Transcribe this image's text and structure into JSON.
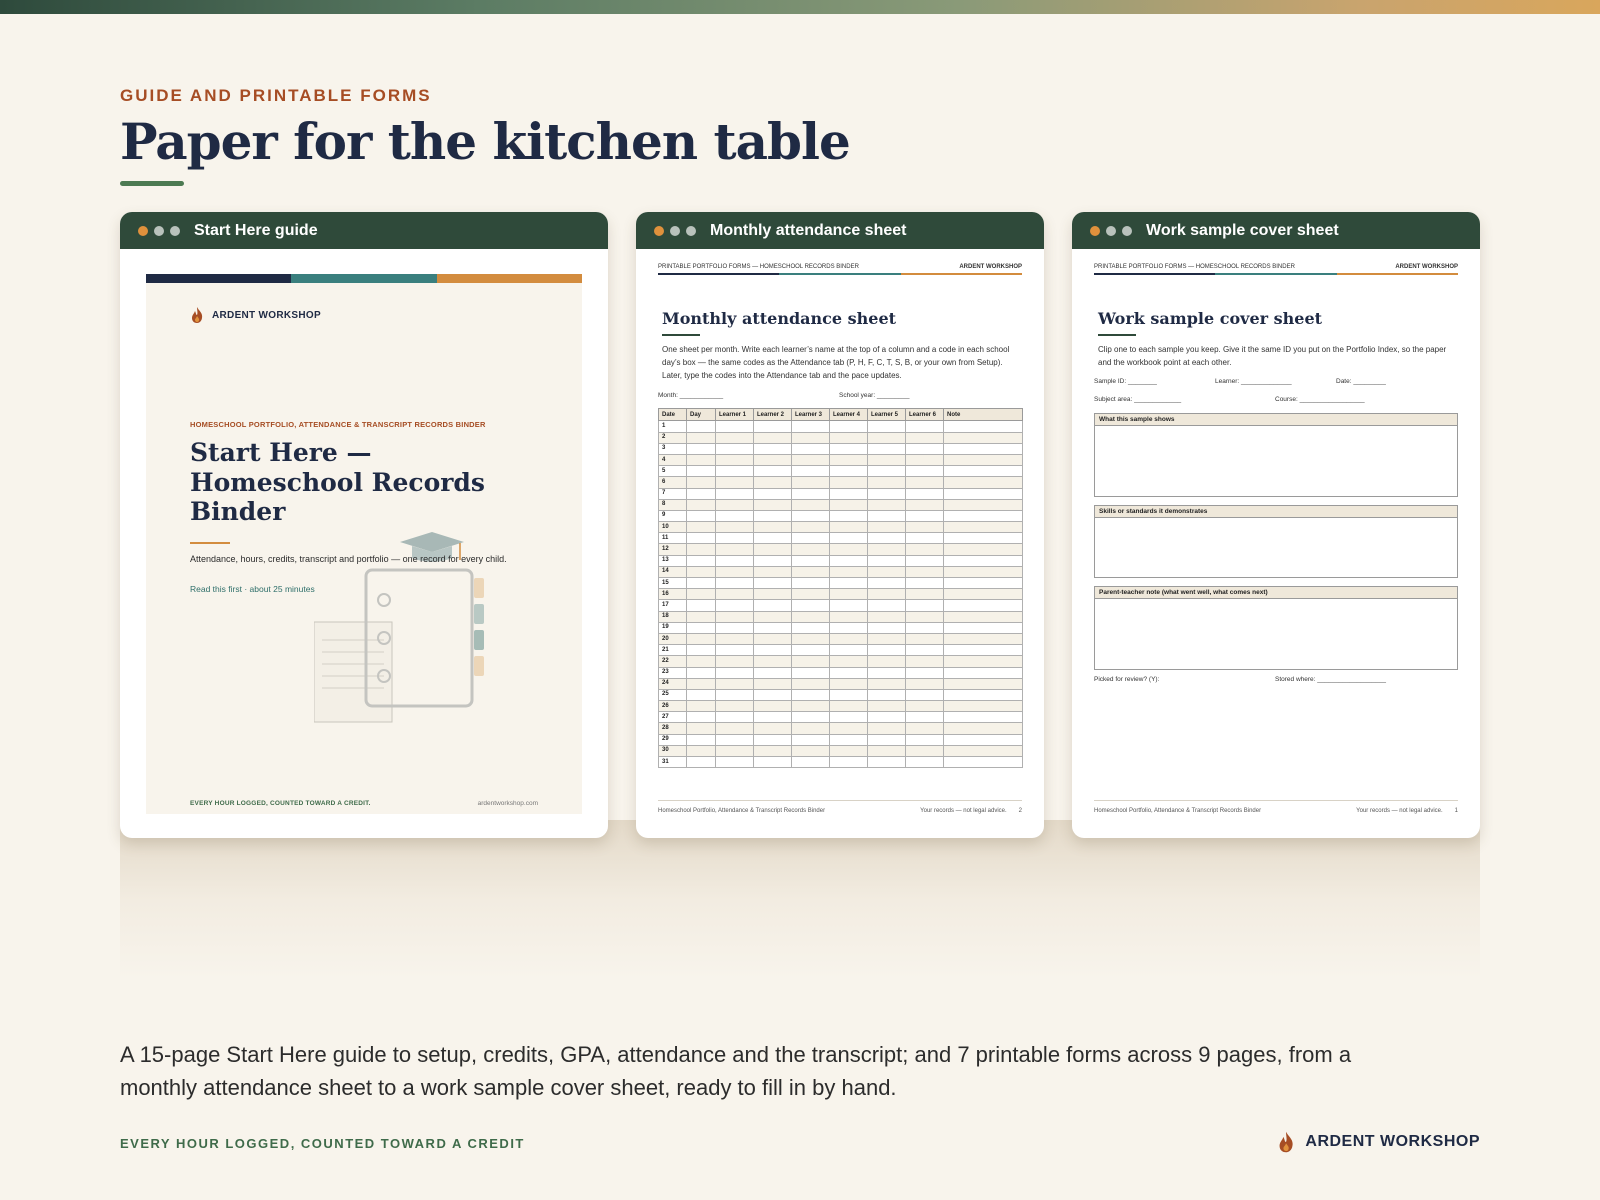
{
  "header": {
    "eyebrow": "GUIDE AND PRINTABLE FORMS",
    "title": "Paper for the kitchen table"
  },
  "colors": {
    "navy": "#1f2a44",
    "teal": "#3a7f7e",
    "amber": "#d38c3e",
    "forest": "#2f4a3a",
    "rust": "#a64d24",
    "background": "#f8f4ec"
  },
  "windows": {
    "guide": {
      "title": "Start Here guide",
      "brand": "ARDENT WORKSHOP",
      "brand_icon": "flame-logo-icon",
      "eyebrow": "HOMESCHOOL PORTFOLIO, ATTENDANCE & TRANSCRIPT RECORDS BINDER",
      "title_lines": [
        "Start Here —",
        "Homeschool Records",
        "Binder"
      ],
      "description": "Attendance, hours, credits, transcript and portfolio — one record for every child.",
      "read_note": "Read this first · about 25 minutes",
      "illustration": "binder-and-graduation-cap-icon",
      "footer_left": "EVERY HOUR LOGGED, COUNTED TOWARD A CREDIT.",
      "footer_right": "ardentworkshop.com"
    },
    "attendance": {
      "title": "Monthly attendance sheet",
      "header_left": "PRINTABLE PORTFOLIO FORMS — HOMESCHOOL RECORDS BINDER",
      "header_right": "ARDENT WORKSHOP",
      "form_title": "Monthly attendance sheet",
      "description": "One sheet per month. Write each learner’s name at the top of a column and a code in each school day’s box — the same codes as the Attendance tab (P, H, F, C, T, S, B, or your own from Setup). Later, type the codes into the Attendance tab and the pace updates.",
      "field_month": "Month: ____________",
      "field_year": "School year: _________",
      "columns": [
        "Date",
        "Day",
        "Learner 1",
        "Learner 2",
        "Learner 3",
        "Learner 4",
        "Learner 5",
        "Learner 6",
        "Note"
      ],
      "rows": [
        "1",
        "2",
        "3",
        "4",
        "5",
        "6",
        "7",
        "8",
        "9",
        "10",
        "11",
        "12",
        "13",
        "14",
        "15",
        "16",
        "17",
        "18",
        "19",
        "20",
        "21",
        "22",
        "23",
        "24",
        "25",
        "26",
        "27",
        "28",
        "29",
        "30",
        "31"
      ],
      "footer_left": "Homeschool Portfolio, Attendance & Transcript Records Binder",
      "footer_mid": "Your records — not legal advice.",
      "footer_page": "2"
    },
    "sample": {
      "title": "Work sample cover sheet",
      "header_left": "PRINTABLE PORTFOLIO FORMS — HOMESCHOOL RECORDS BINDER",
      "header_right": "ARDENT WORKSHOP",
      "form_title": "Work sample cover sheet",
      "description": "Clip one to each sample you keep. Give it the same ID you put on the Portfolio Index, so the paper and the workbook point at each other.",
      "field_sample_id": "Sample ID: ________",
      "field_learner": "Learner: ______________",
      "field_date": "Date: _________",
      "field_subject": "Subject area: _____________",
      "field_course": "Course: __________________",
      "box1": "What this sample shows",
      "box2": "Skills or standards it demonstrates",
      "box3": "Parent-teacher note (what went well, what comes next)",
      "field_review": "Picked for review? (Y):",
      "field_stored": "Stored where: ___________________",
      "footer_left": "Homeschool Portfolio, Attendance & Transcript Records Binder",
      "footer_mid": "Your records — not legal advice.",
      "footer_page": "1"
    }
  },
  "summary": "A 15-page Start Here guide to setup, credits, GPA, attendance and the transcript; and 7 printable forms across 9 pages, from a monthly attendance sheet to a work sample cover sheet, ready to fill in by hand.",
  "footer": {
    "tagline": "EVERY HOUR LOGGED, COUNTED TOWARD A CREDIT",
    "brand": "ARDENT WORKSHOP",
    "brand_icon": "flame-logo-icon"
  }
}
